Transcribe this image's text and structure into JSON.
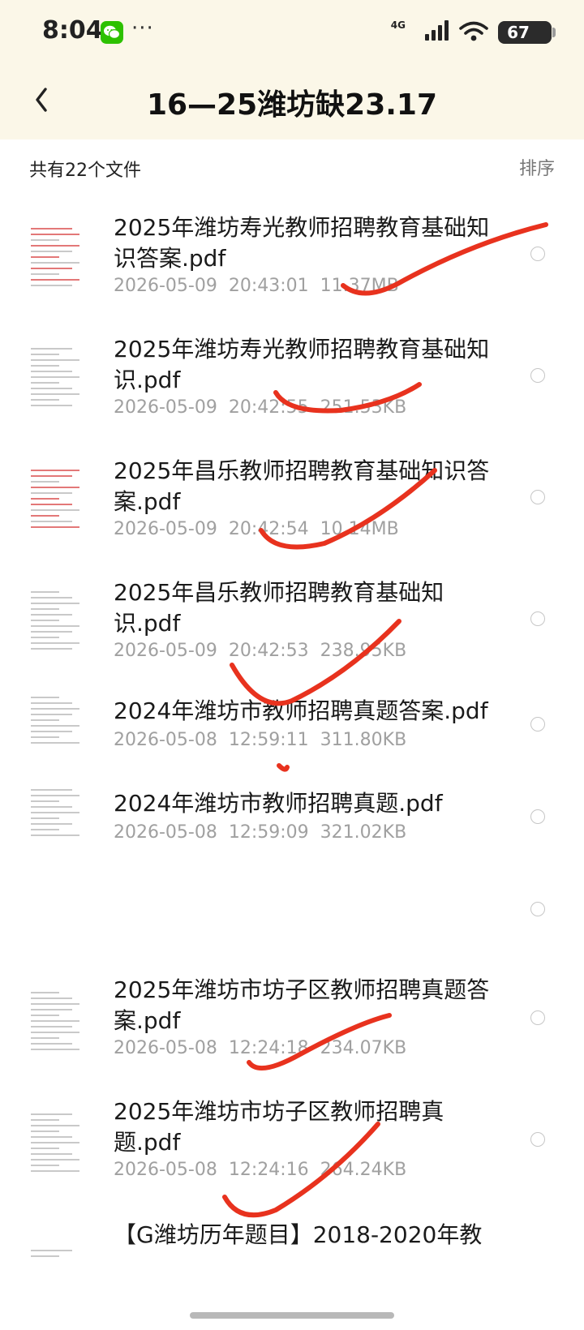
{
  "status": {
    "time": "8:04",
    "more": "···",
    "network": "4G",
    "battery": "67"
  },
  "header": {
    "title": "16—25潍坊缺23.17"
  },
  "summary": {
    "file_count": "共有22个文件",
    "sort_label": "排序"
  },
  "files": [
    {
      "name": "2025年潍坊寿光教师招聘教育基础知识答案.pdf",
      "date": "2026-05-09",
      "time": "20:43:01",
      "size": "11.37MB"
    },
    {
      "name": "2025年潍坊寿光教师招聘教育基础知识.pdf",
      "date": "2026-05-09",
      "time": "20:42:55",
      "size": "251.53KB"
    },
    {
      "name": "2025年昌乐教师招聘教育基础知识答案.pdf",
      "date": "2026-05-09",
      "time": "20:42:54",
      "size": "10.14MB"
    },
    {
      "name": "2025年昌乐教师招聘教育基础知识.pdf",
      "date": "2026-05-09",
      "time": "20:42:53",
      "size": "238.95KB"
    },
    {
      "name": "2024年潍坊市教师招聘真题答案.pdf",
      "date": "2026-05-08",
      "time": "12:59:11",
      "size": "311.80KB"
    },
    {
      "name": "2024年潍坊市教师招聘真题.pdf",
      "date": "2026-05-08",
      "time": "12:59:09",
      "size": "321.02KB"
    },
    {
      "name": "",
      "date": "",
      "time": "",
      "size": ""
    },
    {
      "name": "2025年潍坊市坊子区教师招聘真题答案.pdf",
      "date": "2026-05-08",
      "time": "12:24:18",
      "size": "234.07KB"
    },
    {
      "name": "2025年潍坊市坊子区教师招聘真题.pdf",
      "date": "2026-05-08",
      "time": "12:24:16",
      "size": "264.24KB"
    },
    {
      "name": "【G潍坊历年题目】2018-2020年教",
      "date": "",
      "time": "",
      "size": ""
    }
  ],
  "colors": {
    "header_bg": "#fbf7e8",
    "handwriting": "#e8321e",
    "meta_text": "#a0a0a0"
  }
}
